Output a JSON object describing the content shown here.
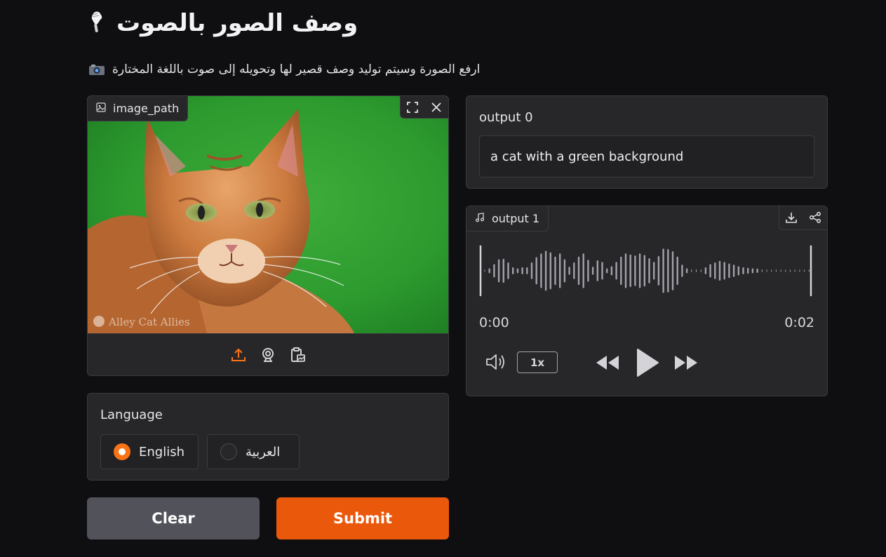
{
  "header": {
    "title": "وصف الصور بالصوت",
    "subtitle": "ارفع الصورة وسيتم توليد وصف قصير لها وتحويله إلى صوت باللغة المختارة",
    "title_icon": "microphone-icon",
    "subtitle_icon": "camera-icon"
  },
  "image_input": {
    "label": "image_path",
    "image_description": "orange tabby cat on green background",
    "watermark": "Alley Cat Allies",
    "sources": [
      "upload-icon",
      "webcam-icon",
      "clipboard-icon"
    ]
  },
  "language": {
    "label": "Language",
    "options": [
      "English",
      "العربية"
    ],
    "selected": "English"
  },
  "buttons": {
    "clear": "Clear",
    "submit": "Submit"
  },
  "output0": {
    "label": "output 0",
    "value": "a cat with a green background"
  },
  "output1": {
    "label": "output 1",
    "time_start": "0:00",
    "time_end": "0:02",
    "playback_rate": "1x"
  },
  "colors": {
    "accent": "#ea580c",
    "background": "#0f0f11",
    "panel": "#27272a"
  }
}
